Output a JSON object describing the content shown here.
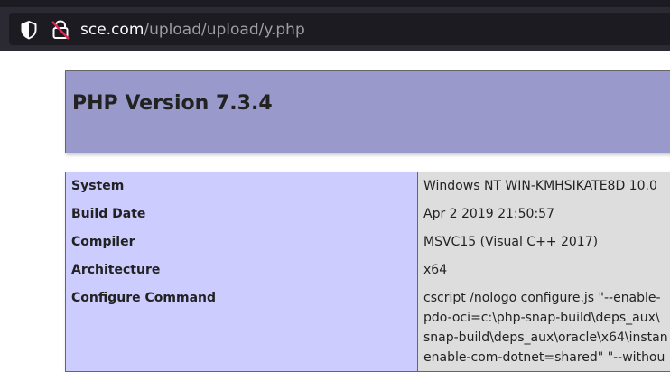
{
  "browser": {
    "url_host": "sce.com",
    "url_path": "/upload/upload/y.php",
    "icons": [
      "shield-icon",
      "insecure-lock-icon"
    ]
  },
  "page": {
    "title": "PHP Version 7.3.4",
    "rows": [
      {
        "label": "System",
        "value": [
          "Windows NT WIN-KMHSIKATE8D 10.0"
        ]
      },
      {
        "label": "Build Date",
        "value": [
          "Apr 2 2019 21:50:57"
        ]
      },
      {
        "label": "Compiler",
        "value": [
          "MSVC15 (Visual C++ 2017)"
        ]
      },
      {
        "label": "Architecture",
        "value": [
          "x64"
        ]
      },
      {
        "label": "Configure Command",
        "value": [
          "cscript /nologo configure.js \"--enable-",
          "pdo-oci=c:\\php-snap-build\\deps_aux\\",
          "snap-build\\deps_aux\\oracle\\x64\\instan",
          "enable-com-dotnet=shared\" \"--withou"
        ]
      }
    ]
  },
  "colors": {
    "header_bg": "#9999cc",
    "label_bg": "#ccccff",
    "value_bg": "#dddddd",
    "toolbar_bg": "#2b2a33",
    "urlfield_bg": "#1c1b22"
  }
}
